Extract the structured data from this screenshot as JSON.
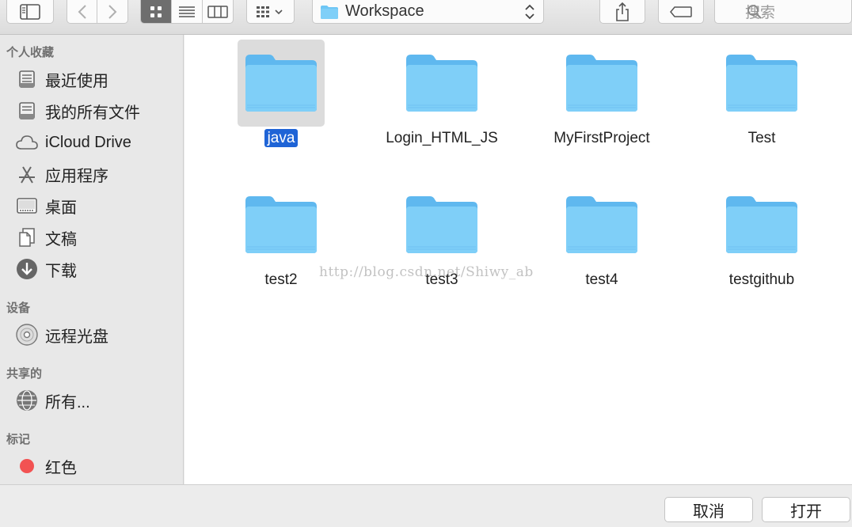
{
  "toolbar": {
    "path_label": "Workspace",
    "search_placeholder": "搜索"
  },
  "sidebar": {
    "sections": [
      {
        "title": "个人收藏"
      },
      {
        "title": "设备"
      },
      {
        "title": "共享的"
      },
      {
        "title": "标记"
      }
    ],
    "favorites": [
      {
        "label": "最近使用",
        "icon": "recents-icon"
      },
      {
        "label": "我的所有文件",
        "icon": "all-files-icon"
      },
      {
        "label": "iCloud Drive",
        "icon": "cloud-icon"
      },
      {
        "label": "应用程序",
        "icon": "applications-icon"
      },
      {
        "label": "桌面",
        "icon": "desktop-icon"
      },
      {
        "label": "文稿",
        "icon": "documents-icon"
      },
      {
        "label": "下载",
        "icon": "downloads-icon"
      }
    ],
    "devices": [
      {
        "label": "远程光盘",
        "icon": "disc-icon"
      }
    ],
    "shared": [
      {
        "label": "所有...",
        "icon": "network-icon"
      }
    ],
    "tags": [
      {
        "label": "红色",
        "icon": "red-tag-icon",
        "color": "#f25252"
      }
    ]
  },
  "files": [
    {
      "name": "java",
      "selected": true
    },
    {
      "name": "Login_HTML_JS"
    },
    {
      "name": "MyFirstProject"
    },
    {
      "name": "Test"
    },
    {
      "name": "test2"
    },
    {
      "name": "test3"
    },
    {
      "name": "test4"
    },
    {
      "name": "testgithub"
    }
  ],
  "watermark": "http://blog.csdn.net/Shiwy_ab",
  "buttons": {
    "cancel": "取消",
    "open": "打开"
  },
  "colors": {
    "folder": "#6ec6f5",
    "selection": "#1f64d6",
    "tag_red": "#f25252"
  }
}
